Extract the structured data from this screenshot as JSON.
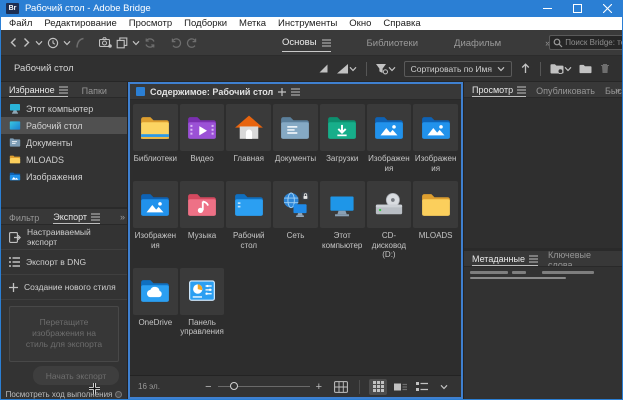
{
  "window": {
    "title": "Рабочий стол - Adobe Bridge",
    "app_badge": "Br"
  },
  "menu": [
    "Файл",
    "Редактирование",
    "Просмотр",
    "Подборки",
    "Метка",
    "Инструменты",
    "Окно",
    "Справка"
  ],
  "workspace_tabs": {
    "active": "Основы",
    "items": [
      "Основы",
      "Библиотеки",
      "Диафильм"
    ]
  },
  "search": {
    "placeholder": "Поиск Bridge: текуща"
  },
  "path_bar": {
    "location": "Рабочий стол",
    "sort_label": "Сортировать по Имя"
  },
  "left": {
    "tabs": {
      "active": "Избранное",
      "items": [
        "Избранное",
        "Папки"
      ]
    },
    "favorites": [
      {
        "label": "Этот компьютер",
        "icon": "computer-sm-icon",
        "selected": false
      },
      {
        "label": "Рабочий стол",
        "icon": "desktop-sm-icon",
        "selected": true
      },
      {
        "label": "Документы",
        "icon": "documents-sm-icon",
        "selected": false
      },
      {
        "label": "MLOADS",
        "icon": "folder-sm-icon",
        "selected": false
      },
      {
        "label": "Изображения",
        "icon": "pictures-sm-icon",
        "selected": false
      }
    ],
    "bottom_tabs": {
      "active": "Экспорт",
      "items": [
        "Фильтр",
        "Экспорт"
      ]
    },
    "export_items": [
      {
        "label": "Настраиваемый экспорт",
        "icon": "custom-export-icon"
      },
      {
        "label": "Экспорт в DNG",
        "icon": "dng-list-icon"
      },
      {
        "label": "Создание нового стиля",
        "icon": "plus-icon"
      }
    ],
    "dropzone_text": "Перетащите изображения на стиль для экспорта",
    "start_export_label": "Начать экспорт",
    "progress_link": "Посмотреть ход выполнения"
  },
  "content": {
    "header": "Содержимое: Рабочий стол",
    "items": [
      {
        "label": "Библиотеки",
        "icon": "libraries-folder-icon"
      },
      {
        "label": "Видео",
        "icon": "video-folder-icon"
      },
      {
        "label": "Главная",
        "icon": "home-icon"
      },
      {
        "label": "Документы",
        "icon": "documents-folder-icon"
      },
      {
        "label": "Загрузки",
        "icon": "downloads-folder-icon"
      },
      {
        "label": "Изображения",
        "icon": "pictures-folder-icon"
      },
      {
        "label": "Изображения",
        "icon": "pictures-folder-icon"
      },
      {
        "label": "Изображения",
        "icon": "pictures-folder-icon"
      },
      {
        "label": "Музыка",
        "icon": "music-folder-icon"
      },
      {
        "label": "Рабочий стол",
        "icon": "desktop-folder-icon"
      },
      {
        "label": "Сеть",
        "icon": "network-icon"
      },
      {
        "label": "Этот компьютер",
        "icon": "computer-icon"
      },
      {
        "label": "CD-дисковод (D:)",
        "icon": "cd-drive-icon"
      },
      {
        "label": "MLOADS",
        "icon": "yellow-folder-icon"
      },
      {
        "label": "OneDrive",
        "icon": "onedrive-folder-icon"
      },
      {
        "label": "Панель управления",
        "icon": "control-panel-icon"
      }
    ],
    "status": {
      "count": "16 эл."
    }
  },
  "right": {
    "tabs": {
      "active": "Просмотр",
      "items": [
        "Просмотр",
        "Опубликовать",
        "Быстр"
      ]
    },
    "meta_tabs": {
      "active": "Метаданные",
      "items": [
        "Метаданные",
        "Ключевые слова"
      ]
    }
  },
  "colors": {
    "titlebar": "#2b7fd4",
    "focus_border": "#3f80d0",
    "panel_bg": "#333333",
    "content_bg": "#2d2d2d"
  }
}
